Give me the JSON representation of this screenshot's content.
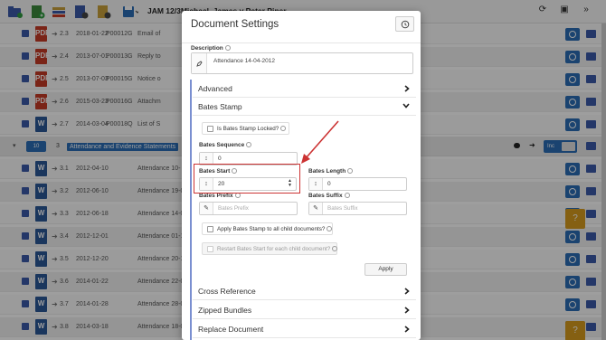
{
  "app": {
    "title": "JAM 12/3Michael, James v Peter Piper",
    "rows_before": [
      {
        "num": "2.3",
        "date": "2018-01-22",
        "id": "P00012G",
        "desc": "Email of",
        "type": "pdf",
        "type_label": "PDF"
      },
      {
        "num": "2.4",
        "date": "2013-07-01",
        "id": "P00013G",
        "desc": "Reply to",
        "type": "pdf",
        "type_label": "PDF"
      },
      {
        "num": "2.5",
        "date": "2013-07-03",
        "id": "P00015G",
        "desc": "Notice o",
        "type": "pdf",
        "type_label": "PDF"
      },
      {
        "num": "2.6",
        "date": "2015-03-23",
        "id": "P00016G",
        "desc": "Attachm",
        "type": "pdf",
        "type_label": "PDF"
      },
      {
        "num": "2.7",
        "date": "2014-03-04",
        "id": "P00018Q",
        "desc": "List of S",
        "type": "word",
        "type_label": "W"
      }
    ],
    "group": {
      "badge": "10",
      "num": "3",
      "title": "Attendance and Evidence Statements",
      "inc_label": "Inc"
    },
    "rows_after": [
      {
        "num": "3.1",
        "date": "2012-04-10",
        "desc": "Attendance 10-",
        "type": "word",
        "type_label": "W"
      },
      {
        "num": "3.2",
        "date": "2012-06-10",
        "desc": "Attendance 19-0",
        "type": "word",
        "type_label": "W"
      },
      {
        "num": "3.3",
        "date": "2012-06-18",
        "desc": "Attendance 14-0",
        "type": "word",
        "type_label": "W"
      },
      {
        "num": "3.4",
        "date": "2012-12-01",
        "desc": "Attendance 01-1",
        "type": "word",
        "type_label": "W"
      },
      {
        "num": "3.5",
        "date": "2012-12-20",
        "desc": "Attendance 20-1",
        "type": "word",
        "type_label": "W"
      },
      {
        "num": "3.6",
        "date": "2014-01-22",
        "desc": "Attendance 22-0",
        "type": "word",
        "type_label": "W"
      },
      {
        "num": "3.7",
        "date": "2014-01-28",
        "desc": "Attendance 28-0",
        "type": "word",
        "type_label": "W"
      },
      {
        "num": "3.8",
        "date": "2014-03-18",
        "desc": "Attendance 18-0",
        "type": "word",
        "type_label": "W"
      }
    ]
  },
  "modal": {
    "title": "Document Settings",
    "description_label": "Description",
    "description_value": "Attendance 14-04-2012",
    "sections": {
      "advanced": "Advanced",
      "bates_stamp": "Bates Stamp",
      "cross_reference": "Cross Reference",
      "zipped_bundles": "Zipped Bundles",
      "replace_document": "Replace Document"
    },
    "bates": {
      "locked_label": "Is Bates Stamp Locked?",
      "sequence_label": "Bates Sequence",
      "sequence_value": "0",
      "start_label": "Bates Start",
      "start_value": "20",
      "length_label": "Bates Length",
      "length_value": "0",
      "prefix_label": "Bates Prefix",
      "prefix_placeholder": "Bates Prefix",
      "suffix_label": "Bates Suffix",
      "suffix_placeholder": "Bates Suffix",
      "apply_all_label": "Apply Bates Stamp to all child documents?",
      "restart_label": "Restart Bates Start for each child document?",
      "apply_button": "Apply"
    }
  },
  "colors": {
    "primary": "#2a6db5",
    "pdf": "#c63b26",
    "word": "#2b5797",
    "highlight": "#cc3333",
    "accent_bar": "#7a8fd0",
    "gold": "#d79b1d"
  }
}
